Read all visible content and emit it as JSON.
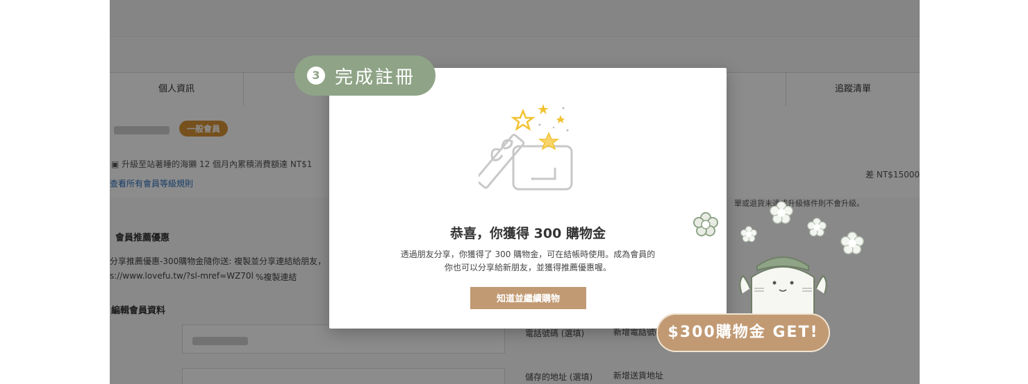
{
  "background": {
    "tabs": {
      "first": "個人資訊",
      "last": "追蹤清單"
    },
    "member_badge": "一般會員",
    "upgrade_prefix": "升級至站著睡的海獺 12 個月內累積消費額達 NT$1",
    "rules_link": "查看所有會員等級規則",
    "diff_text": "差 NT$15000",
    "note_text": "單或退貨未達成升級條件則不會升級。",
    "referral": {
      "heading": "會員推薦優惠",
      "line1": "分享推薦優惠-300購物金隨你送: 複製並分享連結給朋友，",
      "url": "s://www.lovefu.tw/?sl-mref=WZ70l",
      "copy_link": "%複製連結"
    },
    "edit_heading": "編輯會員資料",
    "phone_label": "電話號碼 (選填)",
    "phone_link": "新增電話號碼",
    "address_label": "儲存的地址 (選填)",
    "address_link": "新增送貨地址"
  },
  "modal": {
    "title": "恭喜，你獲得 300 購物金",
    "body_line1": "透過朋友分享，你獲得了 300 購物金，可在結帳時使用。成為會員的",
    "body_line2": "你也可以分享給新朋友，並獲得推薦優惠喔。",
    "button": "知道並繼續購物"
  },
  "step": {
    "number": "3",
    "label": "完成註冊"
  },
  "promo": {
    "label": "$300購物金 GET!"
  },
  "colors": {
    "accent_brown": "#c19a74",
    "sage": "#8fa487",
    "badge": "#d89335",
    "link": "#2a6ebb"
  }
}
